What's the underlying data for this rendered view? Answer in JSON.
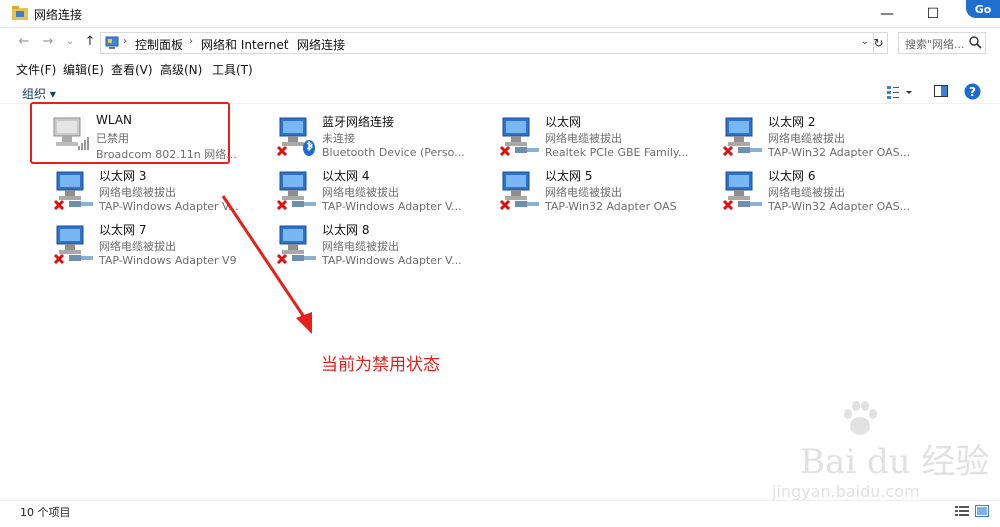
{
  "window": {
    "title": "网络连接",
    "minimize": "—",
    "maximize": "☐",
    "close": "✕",
    "badge": "Go"
  },
  "nav": {
    "back": "←",
    "forward": "→",
    "recent": "⌄",
    "up": "↑"
  },
  "address": {
    "crumbs": [
      "控制面板",
      "网络和 Internet",
      "网络连接"
    ],
    "separator": "›",
    "refresh": "↻",
    "dropdown": "⌄"
  },
  "search": {
    "placeholder": "搜索\"网络..."
  },
  "menu": [
    "文件(F)",
    "编辑(E)",
    "查看(V)",
    "高级(N)",
    "工具(T)"
  ],
  "command": {
    "organize": "组织 ▾"
  },
  "adapters": [
    {
      "name": "WLAN",
      "status": "已禁用",
      "device": "Broadcom 802.11n 网络...",
      "icon": "wifi-disabled-icon"
    },
    {
      "name": "蓝牙网络连接",
      "status": "未连接",
      "device": "Bluetooth Device (Perso...",
      "icon": "bluetooth-icon"
    },
    {
      "name": "以太网",
      "status": "网络电缆被拔出",
      "device": "Realtek PCIe GBE Family...",
      "icon": "ethernet-unplugged-icon"
    },
    {
      "name": "以太网 2",
      "status": "网络电缆被拔出",
      "device": "TAP-Win32 Adapter OAS...",
      "icon": "ethernet-unplugged-icon"
    },
    {
      "name": "以太网 3",
      "status": "网络电缆被拔出",
      "device": "TAP-Windows Adapter V...",
      "icon": "ethernet-unplugged-icon"
    },
    {
      "name": "以太网 4",
      "status": "网络电缆被拔出",
      "device": "TAP-Windows Adapter V...",
      "icon": "ethernet-unplugged-icon"
    },
    {
      "name": "以太网 5",
      "status": "网络电缆被拔出",
      "device": "TAP-Win32 Adapter OAS",
      "icon": "ethernet-unplugged-icon"
    },
    {
      "name": "以太网 6",
      "status": "网络电缆被拔出",
      "device": "TAP-Win32 Adapter OAS...",
      "icon": "ethernet-unplugged-icon"
    },
    {
      "name": "以太网 7",
      "status": "网络电缆被拔出",
      "device": "TAP-Windows Adapter V9",
      "icon": "ethernet-unplugged-icon"
    },
    {
      "name": "以太网 8",
      "status": "网络电缆被拔出",
      "device": "TAP-Windows Adapter V...",
      "icon": "ethernet-unplugged-icon"
    }
  ],
  "annotation": {
    "text": "当前为禁用状态",
    "color": "#e8201b"
  },
  "watermark": {
    "brand": "Bai du 经验",
    "url": "jingyan.baidu.com"
  },
  "statusbar": {
    "count": "10 个项目"
  }
}
